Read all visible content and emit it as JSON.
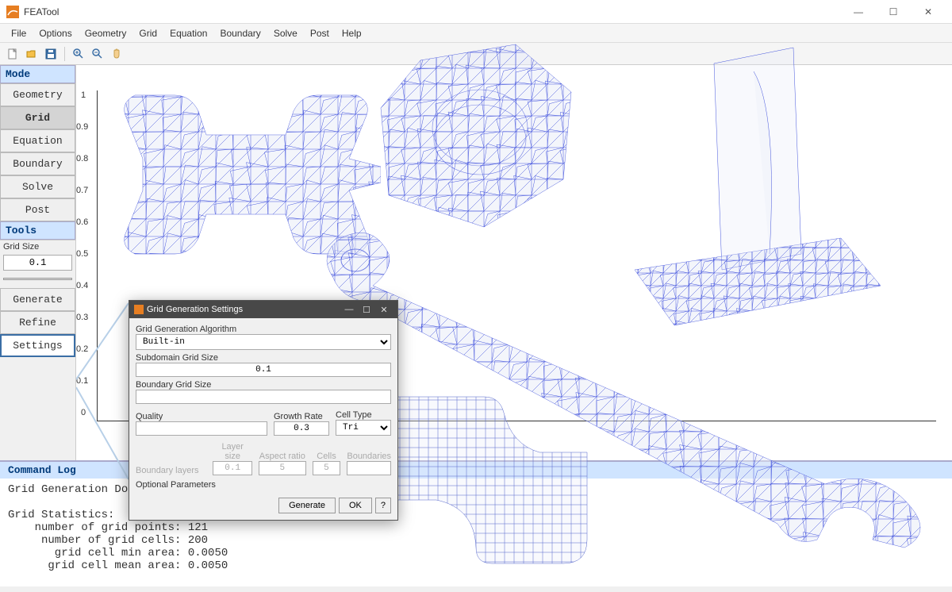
{
  "window": {
    "title": "FEATool",
    "min_icon": "—",
    "max_icon": "☐",
    "close_icon": "✕"
  },
  "menus": [
    "File",
    "Options",
    "Geometry",
    "Grid",
    "Equation",
    "Boundary",
    "Solve",
    "Post",
    "Help"
  ],
  "sidebar": {
    "mode_header": "Mode",
    "modes": [
      "Geometry",
      "Grid",
      "Equation",
      "Boundary",
      "Solve",
      "Post"
    ],
    "active_mode_index": 1,
    "tools_header": "Tools",
    "grid_size_label": "Grid Size",
    "grid_size_value": "0.1",
    "buttons": [
      "Generate",
      "Refine",
      "Settings"
    ],
    "selected_button_index": 2
  },
  "axes": {
    "y_ticks": [
      "1",
      "0.9",
      "0.8",
      "0.7",
      "0.6",
      "0.5",
      "0.4",
      "0.3",
      "0.2",
      "0.1",
      "0"
    ]
  },
  "dialog": {
    "title": "Grid Generation Settings",
    "algorithm_label": "Grid Generation Algorithm",
    "algorithm_value": "Built-in",
    "subdomain_label": "Subdomain Grid Size",
    "subdomain_value": "0.1",
    "boundary_label": "Boundary Grid Size",
    "boundary_value": "",
    "quality_label": "Quality",
    "quality_value": "",
    "growth_label": "Growth Rate",
    "growth_value": "0.3",
    "celltype_label": "Cell Type",
    "celltype_value": "Tri",
    "bl_label": "Boundary layers",
    "bl_layer_size_label": "Layer size",
    "bl_layer_size_value": "0.1",
    "bl_aspect_label": "Aspect ratio",
    "bl_aspect_value": "5",
    "bl_cells_label": "Cells",
    "bl_cells_value": "5",
    "bl_boundaries_label": "Boundaries",
    "optional_label": "Optional Parameters",
    "btn_generate": "Generate",
    "btn_ok": "OK",
    "btn_help": "?"
  },
  "log": {
    "header": "Command Log",
    "lines": [
      "Grid Generation Done.",
      "",
      "Grid Statistics:",
      "    number of grid points: 121",
      "     number of grid cells: 200",
      "       grid cell min area: 0.0050",
      "      grid cell mean area: 0.0050"
    ]
  }
}
